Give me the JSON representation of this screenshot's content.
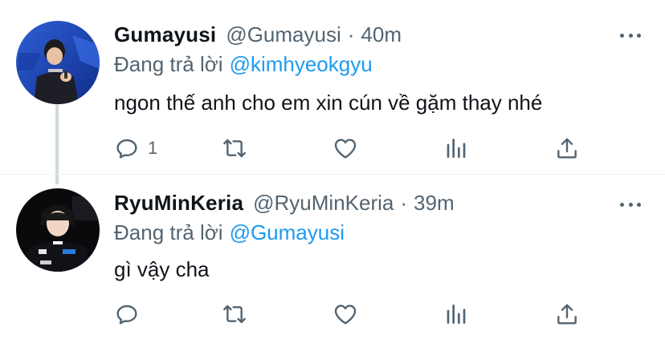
{
  "tweets": [
    {
      "name": "Gumayusi",
      "handle": "@Gumayusi",
      "dot": "·",
      "time": "40m",
      "reply_label": "Đang trả lời",
      "reply_mention": "@kimhyeokgyu",
      "text": "ngon thế anh cho em xin cún về gặm thay nhé",
      "reply_count": "1"
    },
    {
      "name": "RyuMinKeria",
      "handle": "@RyuMinKeria",
      "dot": "·",
      "time": "39m",
      "reply_label": "Đang trả lời",
      "reply_mention": "@Gumayusi",
      "text": "gì vậy cha",
      "reply_count": ""
    }
  ],
  "icons": [
    "reply-icon",
    "retweet-icon",
    "like-icon",
    "stats-icon",
    "share-icon",
    "more-icon"
  ],
  "colors": {
    "text": "#0f1419",
    "secondary": "#536471",
    "link": "#1d9bf0",
    "thread_line": "#cfd9de"
  }
}
